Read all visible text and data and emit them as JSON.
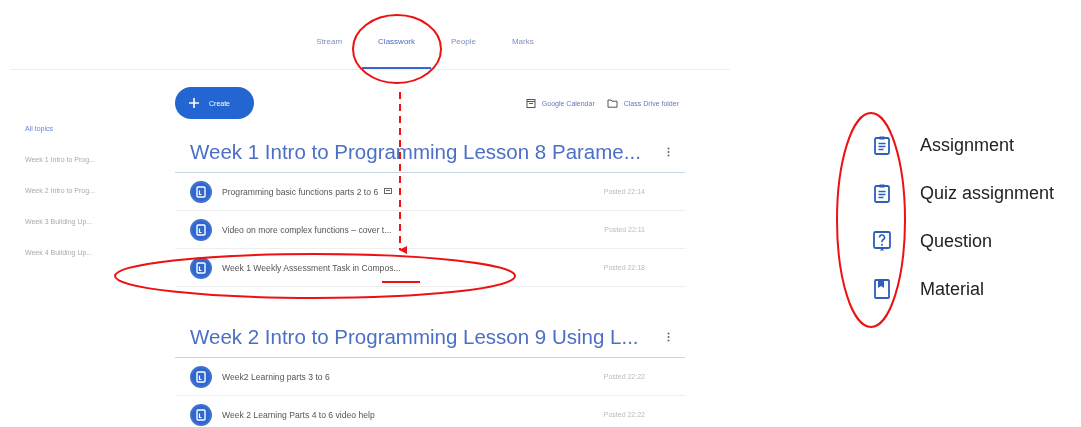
{
  "tabs": [
    {
      "label": "Stream",
      "selected": false
    },
    {
      "label": "Classwork",
      "selected": true
    },
    {
      "label": "People",
      "selected": false
    },
    {
      "label": "Marks",
      "selected": false
    }
  ],
  "create_button": {
    "label": "Create"
  },
  "links": [
    {
      "kind": "calendar",
      "label": "Google Calendar"
    },
    {
      "kind": "folder",
      "label": "Class Drive folder"
    }
  ],
  "sidebar": {
    "items": [
      {
        "label": "All topics",
        "selected": true
      },
      {
        "label": "Week 1 Intro to Prog...",
        "selected": false
      },
      {
        "label": "Week 2 Intro to Prog...",
        "selected": false
      },
      {
        "label": "Week 3 Building Up...",
        "selected": false
      },
      {
        "label": "Week 4 Building Up...",
        "selected": false
      }
    ]
  },
  "topics": [
    {
      "title": "Week 1 Intro to Programming Lesson 8 Parame...",
      "rows": [
        {
          "title": "Programming basic functions parts 2 to 6",
          "posted": "Posted 22:14",
          "comment_icon": true
        },
        {
          "title": "Video on more complex functions – cover t...",
          "posted": "Posted 22:11",
          "comment_icon": false
        },
        {
          "title": "Week 1 Weekly Assessment Task in Compos...",
          "posted": "Posted 22:18",
          "comment_icon": false
        }
      ]
    },
    {
      "title": "Week 2 Intro to Programming Lesson 9 Using L...",
      "rows": [
        {
          "title": "Week2 Learning parts 3 to 6",
          "posted": "Posted 22:22",
          "comment_icon": false
        },
        {
          "title": "Week 2 Learning Parts 4 to 6 video help",
          "posted": "Posted 22:22",
          "comment_icon": false
        }
      ]
    }
  ],
  "legend": [
    {
      "kind": "assignment",
      "label": "Assignment"
    },
    {
      "kind": "quiz",
      "label": "Quiz assignment"
    },
    {
      "kind": "question",
      "label": "Question"
    },
    {
      "kind": "material",
      "label": "Material"
    }
  ],
  "annotations": [
    {
      "kind": "circle"
    },
    {
      "kind": "arrow"
    },
    {
      "kind": "ellipse"
    },
    {
      "kind": "underline"
    },
    {
      "kind": "ellipse"
    }
  ]
}
